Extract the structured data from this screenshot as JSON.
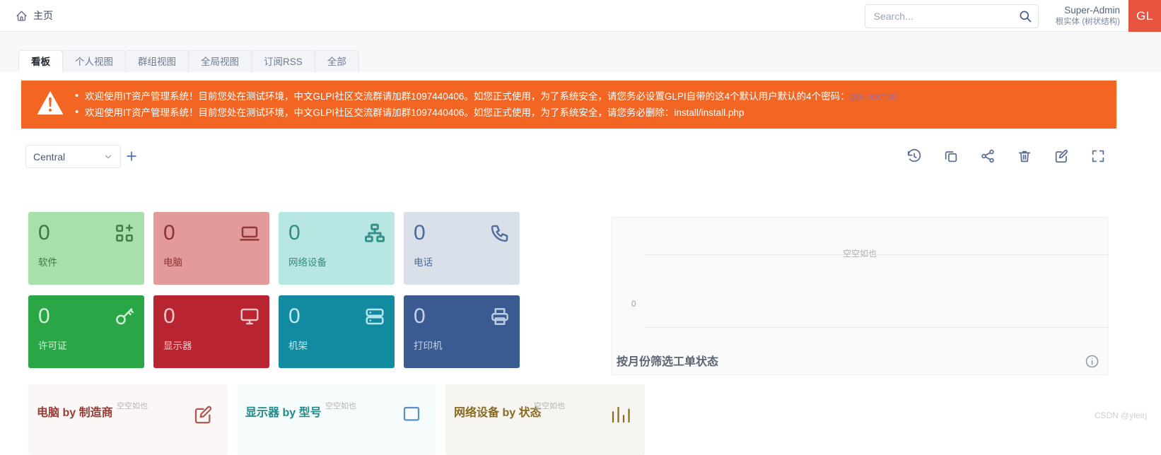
{
  "header": {
    "home_icon": "home-icon",
    "breadcrumb": "主页",
    "search": {
      "placeholder": "Search...",
      "value": "",
      "icon": "search-icon"
    },
    "user": {
      "name": "Super-Admin",
      "entity": "根实体 (树状结构)",
      "avatar_text": "GL"
    }
  },
  "tabs": [
    {
      "label": "看板",
      "active": true
    },
    {
      "label": "个人视图",
      "active": false
    },
    {
      "label": "群组视图",
      "active": false
    },
    {
      "label": "全局视图",
      "active": false
    },
    {
      "label": "订阅RSS",
      "active": false
    },
    {
      "label": "全部",
      "active": false
    }
  ],
  "banner": {
    "color": "#f26522",
    "icon": "warning-triangle-icon",
    "messages": [
      {
        "text": "欢迎使用IT资产管理系统！目前您处在测试环境，中文GLPI社区交流群请加群1097440406。如您正式使用，为了系统安全，请您务必设置GLPI自带的这4个默认用户默认的4个密码：",
        "link": "glpi normal"
      },
      {
        "text": "欢迎使用IT资产管理系统！目前您处在测试环境，中文GLPI社区交流群请加群1097440406。如您正式使用，为了系统安全，请您务必删除：install/install.php",
        "link": ""
      }
    ]
  },
  "toolbar": {
    "dashboard_select": "Central",
    "add_label": "+",
    "icons": [
      {
        "name": "history-icon",
        "title": "历史"
      },
      {
        "name": "copy-icon",
        "title": "复制"
      },
      {
        "name": "share-icon",
        "title": "分享"
      },
      {
        "name": "trash-icon",
        "title": "删除"
      },
      {
        "name": "edit-icon",
        "title": "编辑"
      },
      {
        "name": "fullscreen-icon",
        "title": "全屏"
      }
    ]
  },
  "tiles": [
    {
      "count": "0",
      "label": "软件",
      "bg": "#a8dfaa",
      "fg": "#3c7a43",
      "icon": "apps-add-icon"
    },
    {
      "count": "0",
      "label": "电脑",
      "bg": "#e29a9a",
      "fg": "#8e3333",
      "icon": "laptop-icon"
    },
    {
      "count": "0",
      "label": "网络设备",
      "bg": "#b8e6e2",
      "fg": "#2f8d86",
      "icon": "network-icon"
    },
    {
      "count": "0",
      "label": "电话",
      "bg": "#d9e0ea",
      "fg": "#4a6a9a",
      "icon": "phone-icon"
    },
    {
      "count": "0",
      "label": "许可证",
      "bg": "#2aa646",
      "fg": "#d5f2dc",
      "icon": "key-icon"
    },
    {
      "count": "0",
      "label": "显示器",
      "bg": "#b82430",
      "fg": "#f2c9cd",
      "icon": "monitor-icon"
    },
    {
      "count": "0",
      "label": "机架",
      "bg": "#128ba0",
      "fg": "#bfeaf2",
      "icon": "server-rack-icon"
    },
    {
      "count": "0",
      "label": "打印机",
      "bg": "#3a5a92",
      "fg": "#c6d3e8",
      "icon": "printer-icon"
    }
  ],
  "chart_data": {
    "type": "bar",
    "title": "按月份筛选工单状态",
    "categories": [],
    "values": [],
    "series": [],
    "empty_text": "空空如也",
    "ylabel": "",
    "xlabel": "",
    "yticks": [
      "0"
    ],
    "ylim": [
      0,
      1
    ],
    "grid": true,
    "legend": "none",
    "info_icon": "info-circle-icon"
  },
  "bottom_widgets": [
    {
      "title": "电脑 by 制造商",
      "empty": "空空如也",
      "bg": "#fbf7f6",
      "fg": "#9a3b33",
      "icon": "edit-pencil-icon"
    },
    {
      "title": "显示器 by 型号",
      "empty": "空空如也",
      "bg": "#f6fbfb",
      "fg": "#1f8a8a",
      "icon": "square-icon"
    },
    {
      "title": "网络设备 by 状态",
      "empty": "空空如也",
      "bg": "#f7f5f0",
      "fg": "#8a6a20",
      "icon": "bar-chart-icon"
    }
  ],
  "watermark": "CSDN @yleirj"
}
